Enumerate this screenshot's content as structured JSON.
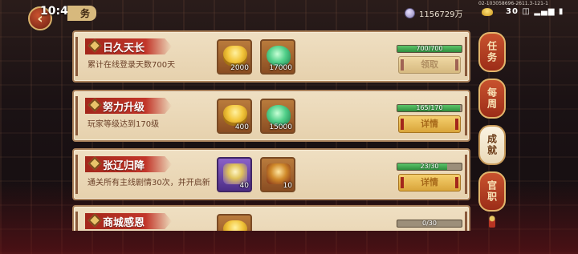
{
  "statusbar": {
    "time": "10:43",
    "sys_info": "02-103058696-2611.3-121-1",
    "sys_icons": "30 ◫ ▂▄▆ ▮"
  },
  "header": {
    "title_suffix": "务",
    "currency_value": "1156729万"
  },
  "tasks": [
    {
      "title": "日久天长",
      "desc": "累计在线登录天数700天",
      "rewards": [
        {
          "icon": "gold-ingot-icon",
          "qty": "2000"
        },
        {
          "icon": "jade-icon",
          "qty": "17000"
        }
      ],
      "progress_text": "700/700",
      "progress": 1.0,
      "button": "领取"
    },
    {
      "title": "努力升级",
      "desc": "玩家等级达到170级",
      "rewards": [
        {
          "icon": "gold-ingot-icon",
          "qty": "400"
        },
        {
          "icon": "jade-icon",
          "qty": "15000"
        }
      ],
      "progress_text": "165/170",
      "progress": 0.97,
      "button": "详情"
    },
    {
      "title": "张辽归降",
      "desc": "通关所有主线剧情30次，并开启新",
      "rewards": [
        {
          "icon": "hero-portrait-icon",
          "qty": "40"
        },
        {
          "icon": "hero-weapon-icon",
          "qty": "10"
        }
      ],
      "progress_text": "23/30",
      "progress": 0.77,
      "button": "详情"
    },
    {
      "title": "商城感恩",
      "desc": "",
      "rewards": [
        {
          "icon": "gold-ingot-icon",
          "qty": ""
        }
      ],
      "progress_text": "0/30",
      "progress": 0.0,
      "button": ""
    }
  ],
  "tabs": [
    {
      "label": "任务",
      "active": false
    },
    {
      "label": "每周",
      "active": false
    },
    {
      "label": "成就",
      "active": true
    },
    {
      "label": "官职",
      "active": false
    }
  ]
}
